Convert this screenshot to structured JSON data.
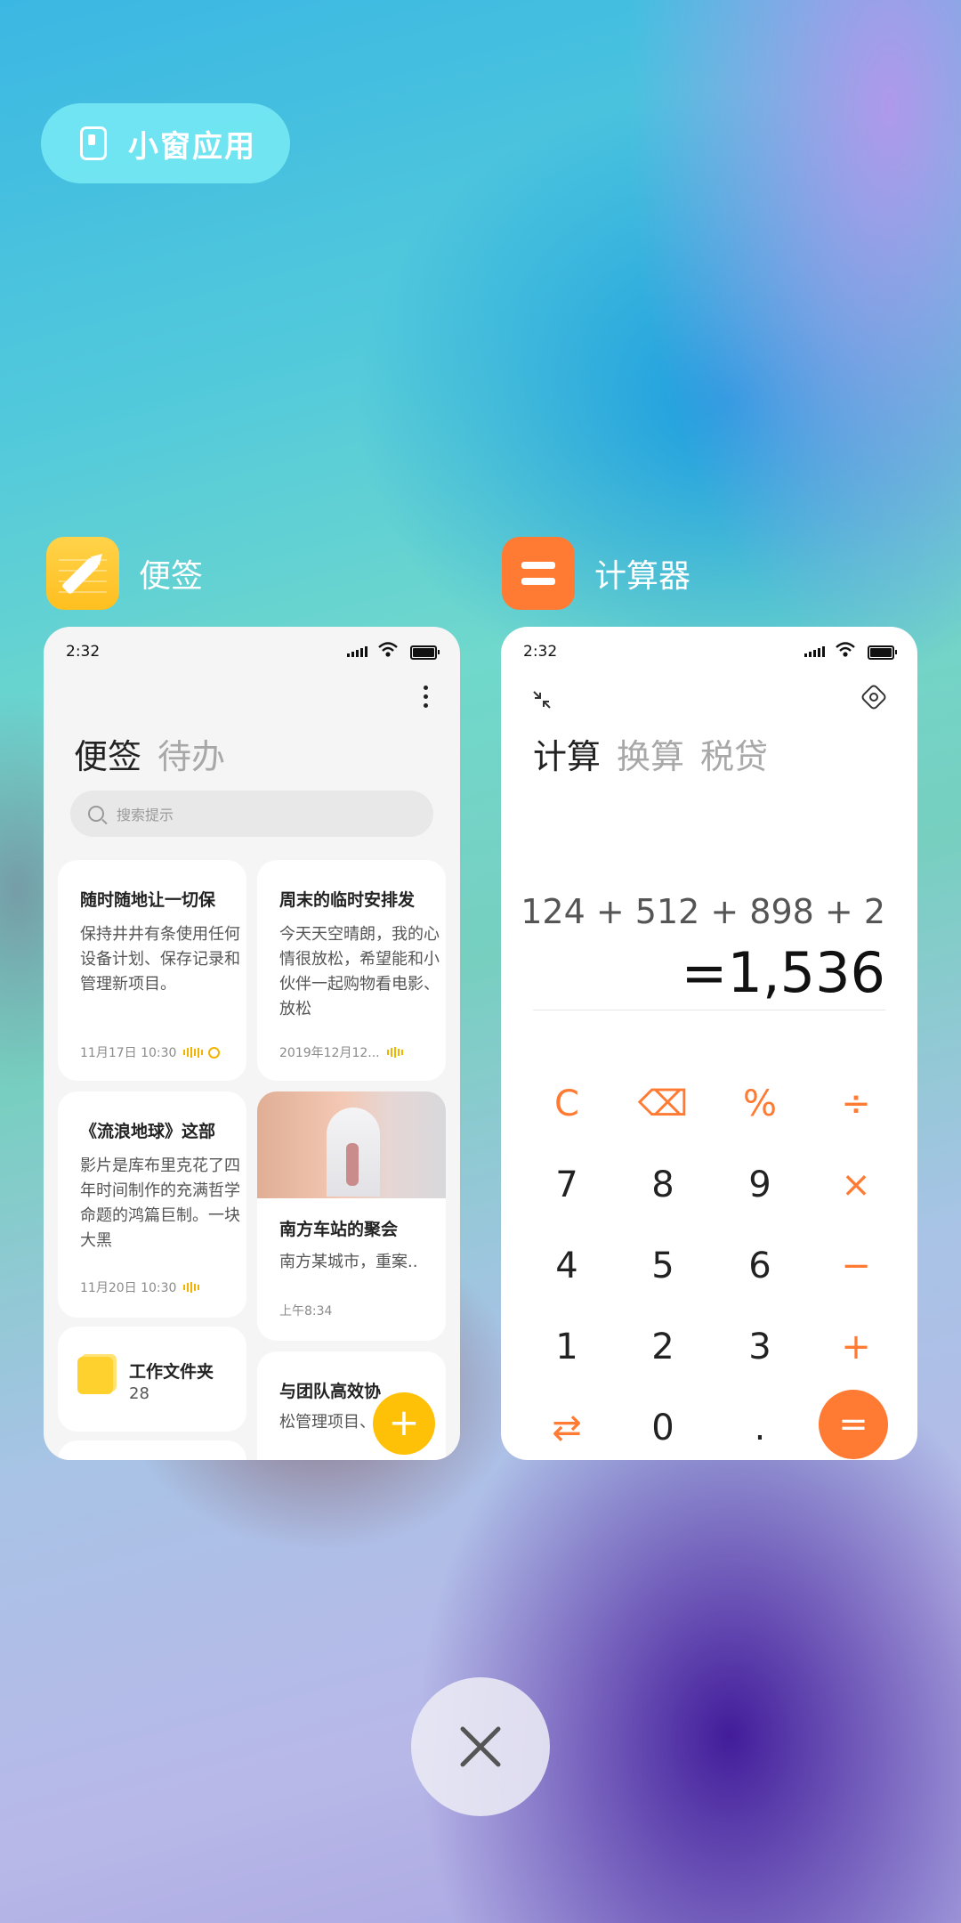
{
  "floating_window": {
    "label": "小窗应用",
    "icon": "floating-window-icon"
  },
  "apps": [
    {
      "name": "便签",
      "icon": "notes-pencil-icon",
      "color": "#FFC21F"
    },
    {
      "name": "计算器",
      "icon": "calculator-equals-icon",
      "color": "#FF7A33"
    }
  ],
  "notes": {
    "status_time": "2:32",
    "tabs": [
      "便签",
      "待办"
    ],
    "search_placeholder": "搜索提示",
    "cards": [
      {
        "title": "随时随地让一切保",
        "body": "保持井井有条使用任何设备计划、保存记录和管理新项目。",
        "meta": "11月17日 10:30"
      },
      {
        "title": "周末的临时安排发",
        "body": "今天天空晴朗，我的心情很放松，希望能和小伙伴一起购物看电影、放松",
        "meta": "2019年12月12..."
      },
      {
        "title": "《流浪地球》这部",
        "body": "影片是库布里克花了四年时间制作的充满哲学命题的鸿篇巨制。一块大黑",
        "meta": "11月20日 10:30"
      },
      {
        "title": "南方车站的聚会",
        "body": "南方某城市，重案..",
        "meta": "上午8:34"
      },
      {
        "title": "与团队高效协",
        "body": "松管理项目、"
      }
    ],
    "folder": {
      "name": "工作文件夹",
      "count": "28"
    },
    "fab": "+"
  },
  "calculator": {
    "status_time": "2:32",
    "tabs": [
      "计算",
      "换算",
      "税贷"
    ],
    "expression": "124 + 512 + 898 + 2",
    "result": "=1,536",
    "keys": [
      [
        "C",
        "⌫",
        "%",
        "÷"
      ],
      [
        "7",
        "8",
        "9",
        "×"
      ],
      [
        "4",
        "5",
        "6",
        "−"
      ],
      [
        "1",
        "2",
        "3",
        "+"
      ],
      [
        "⇄",
        "0",
        ".",
        "="
      ]
    ]
  },
  "close": {
    "icon": "close-icon"
  }
}
